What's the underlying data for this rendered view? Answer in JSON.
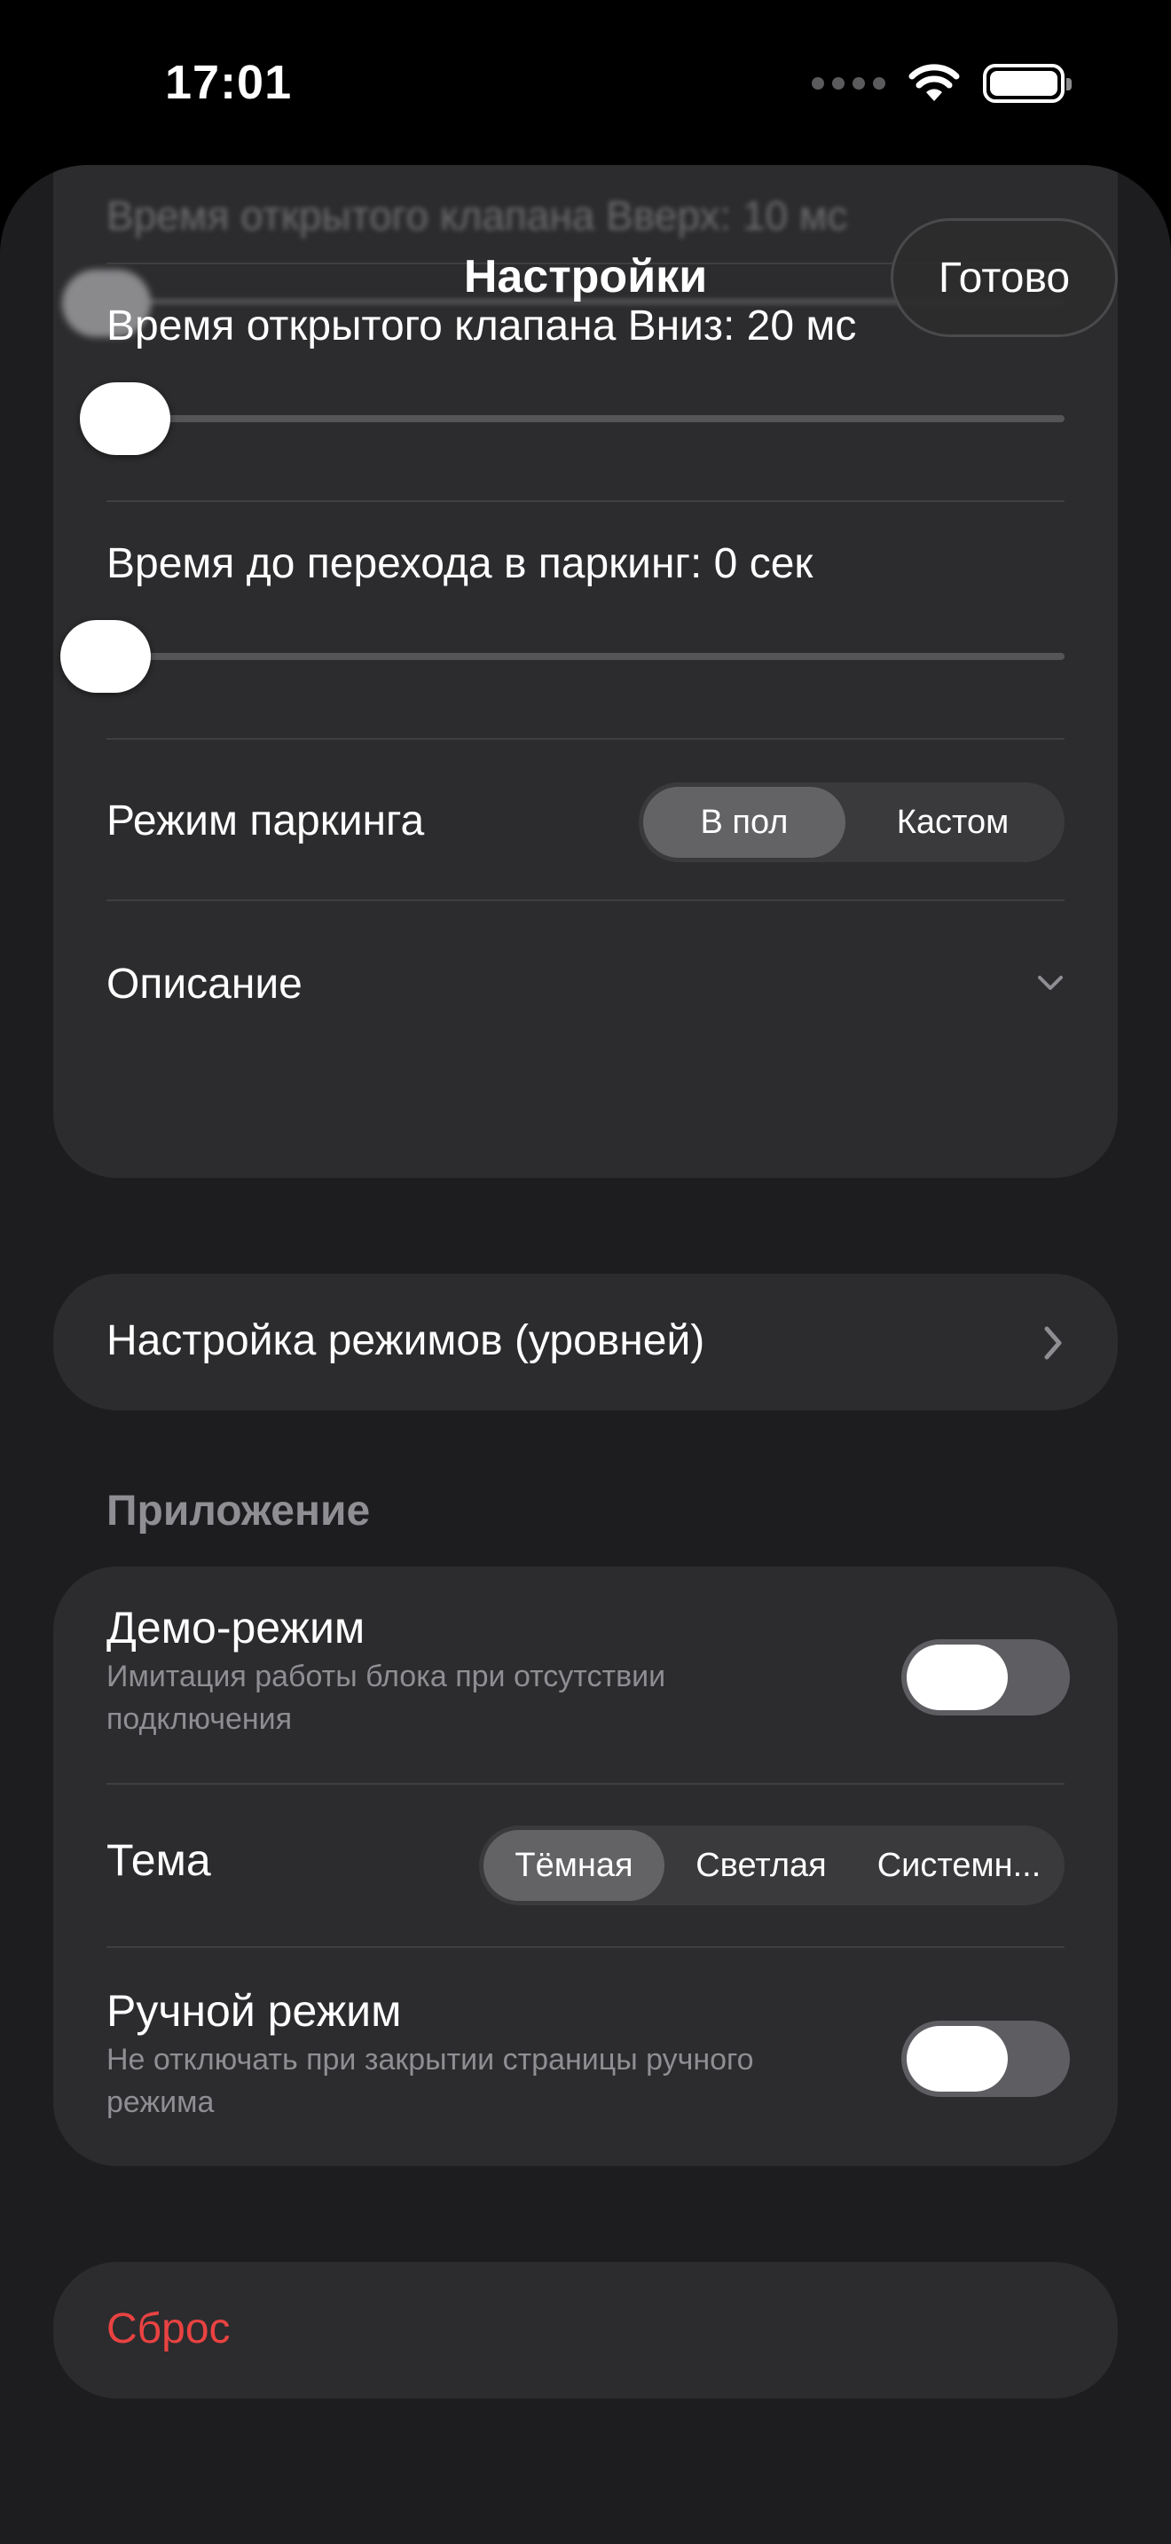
{
  "status_bar": {
    "time": "17:01"
  },
  "nav": {
    "title": "Настройки",
    "done_label": "Готово"
  },
  "valve_settings": {
    "hidden_row_label": "Время открытого клапана Вверх: 10 мс",
    "rows": [
      {
        "label": "Время открытого клапана Вниз: 20 мс",
        "value_fraction": 0.02
      },
      {
        "label": "Время до перехода в паркинг: 0 сек",
        "value_fraction": 0.0
      }
    ],
    "parking_mode": {
      "label": "Режим паркинга",
      "options": [
        "В пол",
        "Кастом"
      ],
      "selected": "В пол"
    },
    "description_label": "Описание"
  },
  "modes_link": {
    "label": "Настройка режимов (уровней)"
  },
  "app_section": {
    "header": "Приложение",
    "demo": {
      "title": "Демо-режим",
      "subtitle": "Имитация работы блока при отсутствии подключения",
      "enabled": false
    },
    "theme": {
      "label": "Тема",
      "options": [
        "Тёмная",
        "Светлая",
        "Системн..."
      ],
      "selected": "Тёмная"
    },
    "manual": {
      "title": "Ручной режим",
      "subtitle": "Не отключать при закрытии страницы ручного режима",
      "enabled": false
    }
  },
  "reset": {
    "label": "Сброс",
    "color": "#ea4242"
  },
  "colors": {
    "background": "#1d1d1f",
    "card": "#2c2c2e",
    "accent_destructive": "#ea4242"
  }
}
